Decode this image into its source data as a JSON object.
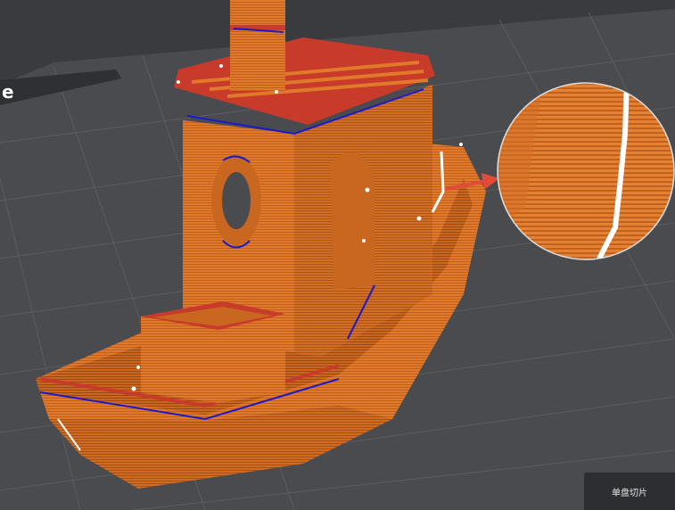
{
  "app": {
    "slice_plate_label": "单盘切片"
  },
  "colors": {
    "background": "#3a3b3e",
    "plate": "#4a4b4f",
    "grid_line": "#5b5c60",
    "model": "#e07a2a",
    "model_shade": "#b8591a",
    "wall_red": "#c83a2a",
    "seam_blue": "#1a1acc",
    "seam_white": "#ffffff",
    "callout_arrow": "#e24a3a"
  },
  "icons": {
    "zoom_callout": "magnifier-circle-icon",
    "arrow": "callout-arrow-icon"
  }
}
